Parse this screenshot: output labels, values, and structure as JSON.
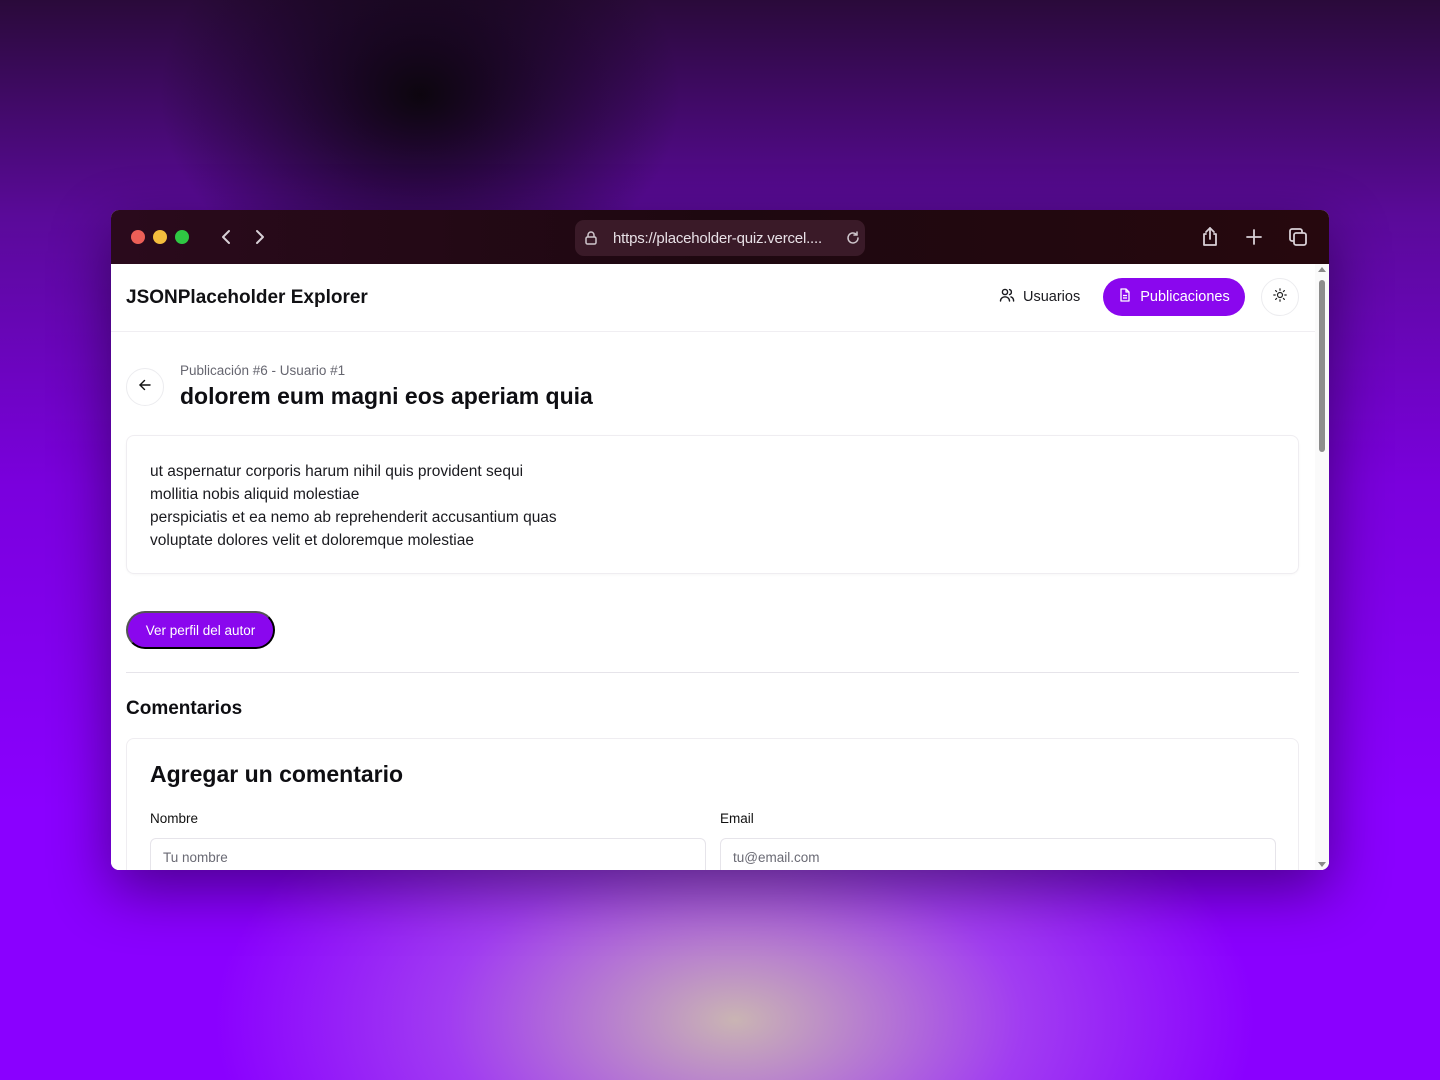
{
  "browser": {
    "url": "https://placeholder-quiz.vercel...."
  },
  "header": {
    "brand": "JSONPlaceholder Explorer",
    "nav": {
      "users_label": "Usuarios",
      "posts_label": "Publicaciones"
    }
  },
  "post": {
    "meta": "Publicación #6 - Usuario #1",
    "title": "dolorem eum magni eos aperiam quia",
    "body_lines": [
      "ut aspernatur corporis harum nihil quis provident sequi",
      "mollitia nobis aliquid molestiae",
      "perspiciatis et ea nemo ab reprehenderit accusantium quas",
      "voluptate dolores velit et doloremque molestiae"
    ],
    "author_button_label": "Ver perfil del autor"
  },
  "comments": {
    "heading": "Comentarios",
    "form": {
      "title": "Agregar un comentario",
      "name_label": "Nombre",
      "name_placeholder": "Tu nombre",
      "email_label": "Email",
      "email_placeholder": "tu@email.com"
    }
  },
  "colors": {
    "accent": "#8a07ee",
    "background_gradient_main": "#8a00ff"
  },
  "icons": {
    "back": "arrow-left-icon",
    "users": "users-icon",
    "posts": "file-text-icon",
    "theme": "sun-icon"
  }
}
